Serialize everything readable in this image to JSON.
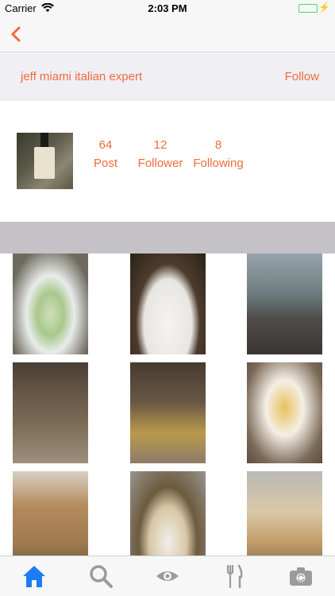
{
  "status_bar": {
    "carrier": "Carrier",
    "time": "2:03 PM",
    "battery_color": "#4cd964"
  },
  "nav": {
    "back_icon": "chevron-left-icon"
  },
  "profile": {
    "username": "jeff miami italian expert",
    "follow_label": "Follow",
    "stats": {
      "posts_count": "64",
      "posts_label": "Post",
      "followers_count": "12",
      "followers_label": "Follower",
      "following_count": "8",
      "following_label": "Following"
    }
  },
  "photos": [
    {
      "name": "pasta-with-greens"
    },
    {
      "name": "plated-appetizer"
    },
    {
      "name": "wine-glasses-on-patio"
    },
    {
      "name": "beer-bottles-in-bar"
    },
    {
      "name": "two-beer-bottles"
    },
    {
      "name": "egg-dish-on-plate"
    },
    {
      "name": "pastries-display"
    },
    {
      "name": "bagel-with-cream-cheese"
    },
    {
      "name": "bagel-display-case"
    }
  ],
  "tab_bar": {
    "items": [
      "home-icon",
      "search-icon",
      "eye-icon",
      "fork-knife-icon",
      "camera-icon"
    ],
    "active": "home-icon",
    "active_color": "#1e7cf2",
    "inactive_color": "#9b9b9b"
  },
  "colors": {
    "accent": "#f26b3a"
  }
}
